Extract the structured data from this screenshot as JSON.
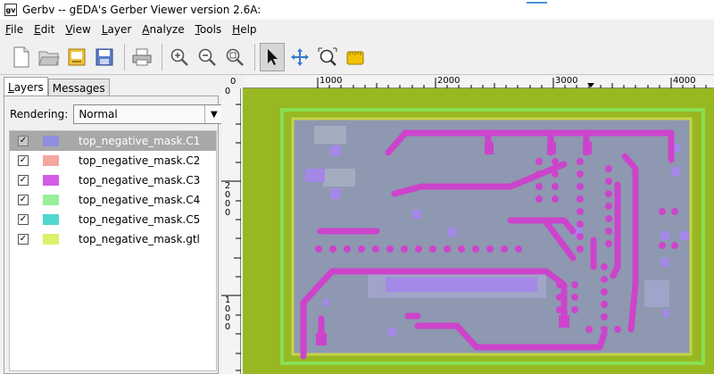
{
  "window": {
    "title": "Gerbv -- gEDA's Gerber Viewer version 2.6A:"
  },
  "menu": [
    {
      "label": "File",
      "key": "F"
    },
    {
      "label": "Edit",
      "key": "E"
    },
    {
      "label": "View",
      "key": "V"
    },
    {
      "label": "Layer",
      "key": "L"
    },
    {
      "label": "Analyze",
      "key": "A"
    },
    {
      "label": "Tools",
      "key": "T"
    },
    {
      "label": "Help",
      "key": "H"
    }
  ],
  "toolbar": {
    "buttons": [
      {
        "name": "new-file-icon"
      },
      {
        "name": "open-folder-icon"
      },
      {
        "name": "reload-icon"
      },
      {
        "name": "save-icon"
      },
      {
        "name": "print-icon"
      },
      {
        "name": "zoom-in-icon"
      },
      {
        "name": "zoom-out-icon"
      },
      {
        "name": "zoom-fit-icon"
      },
      {
        "name": "pointer-icon"
      },
      {
        "name": "pan-icon"
      },
      {
        "name": "zoom-area-icon"
      },
      {
        "name": "measure-icon"
      }
    ]
  },
  "tabs": [
    {
      "label": "Layers",
      "key": "L"
    },
    {
      "label": "Messages"
    }
  ],
  "rendering": {
    "label": "Rendering:",
    "value": "Normal"
  },
  "layers": [
    {
      "name": "top_negative_mask.C1",
      "color": "#8f8fdd",
      "checked": true,
      "selected": true
    },
    {
      "name": "top_negative_mask.C2",
      "color": "#f4a6a0",
      "checked": true,
      "selected": false
    },
    {
      "name": "top_negative_mask.C3",
      "color": "#d45ce8",
      "checked": true,
      "selected": false
    },
    {
      "name": "top_negative_mask.C4",
      "color": "#98f098",
      "checked": true,
      "selected": false
    },
    {
      "name": "top_negative_mask.C5",
      "color": "#4ed8d0",
      "checked": true,
      "selected": false
    },
    {
      "name": "top_negative_mask.gtl",
      "color": "#dcf06a",
      "checked": true,
      "selected": false
    }
  ],
  "ruler": {
    "h_labels": [
      "0",
      "1000",
      "2000",
      "3000",
      "4000"
    ],
    "v_labels": [
      "0",
      "2000",
      "1000"
    ]
  },
  "colors": {
    "board": "#98b822",
    "outline": "#86e052",
    "fill": "#8e98b0",
    "trace": "#cc44cc",
    "pad": "#a488e8"
  }
}
